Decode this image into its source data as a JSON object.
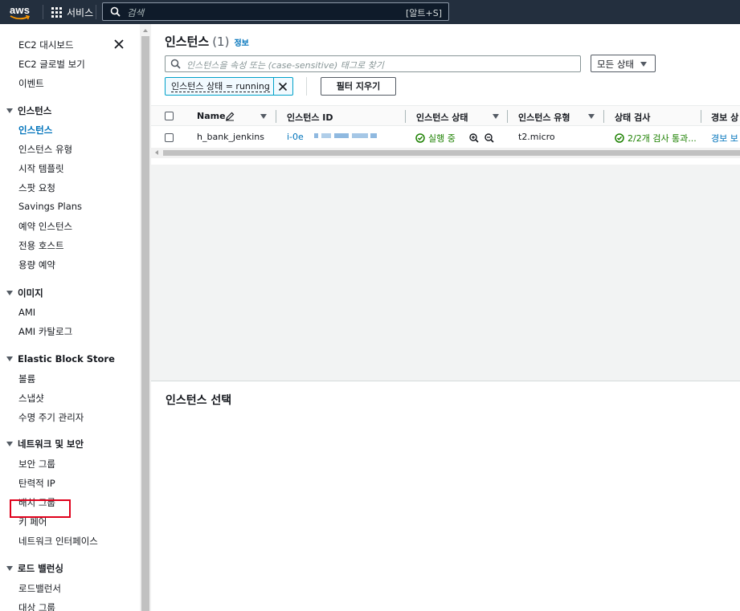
{
  "topnav": {
    "logo": "aws",
    "services_label": "서비스",
    "search_placeholder": "검색",
    "search_shortcut": "[알트+S]"
  },
  "sidebar": {
    "top_items": [
      "EC2 대시보드",
      "EC2 글로벌 보기",
      "이벤트"
    ],
    "sections": [
      {
        "title": "인스턴스",
        "items": [
          "인스턴스",
          "인스턴스 유형",
          "시작 템플릿",
          "스팟 요청",
          "Savings Plans",
          "예약 인스턴스",
          "전용 호스트",
          "용량 예약"
        ]
      },
      {
        "title": "이미지",
        "items": [
          "AMI",
          "AMI 카탈로그"
        ]
      },
      {
        "title": "Elastic Block Store",
        "items": [
          "볼륨",
          "스냅샷",
          "수명 주기 관리자"
        ]
      },
      {
        "title": "네트워크 및 보안",
        "items": [
          "보안 그룹",
          "탄력적 IP",
          "배치 그룹",
          "키 페어",
          "네트워크 인터페이스"
        ]
      },
      {
        "title": "로드 밸런싱",
        "items": [
          "로드밸런서",
          "대상 그룹"
        ]
      }
    ],
    "active_item": "인스턴스",
    "highlighted_item": "탄력적 IP"
  },
  "main": {
    "title": "인스턴스",
    "count": "(1)",
    "info_link": "정보",
    "filter_placeholder": "인스턴스을 속성 또는 (case-sensitive) 태그로 찾기",
    "state_select": "모든 상태",
    "filter_token": "인스턴스 상태 = running",
    "clear_filters": "필터 지우기",
    "columns": [
      "Name",
      "인스턴스 ID",
      "인스턴스 상태",
      "인스턴스 유형",
      "상태 검사",
      "경보 상"
    ],
    "rows": [
      {
        "name": "h_bank_jenkins",
        "instance_id": "i-0e",
        "state": "실행 중",
        "type": "t2.micro",
        "status_check": "2/2개 검사 통과...",
        "alarm": "경보 보"
      }
    ],
    "detail_title": "인스턴스 선택"
  },
  "colors": {
    "nav_bg": "#232f3e",
    "link": "#0073bb",
    "success": "#1d8102",
    "highlight_border": "#e0001b"
  }
}
